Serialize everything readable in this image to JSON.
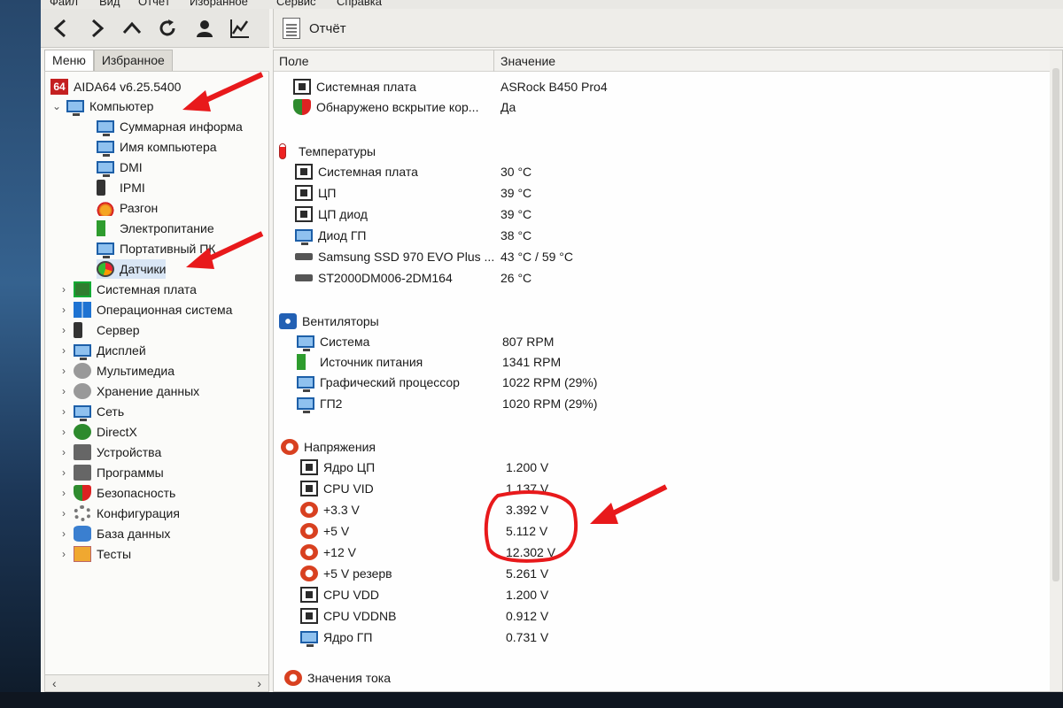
{
  "menubar": [
    "Файл",
    "Вид",
    "Отчёт",
    "Избранное",
    "Сервис",
    "Справка"
  ],
  "toolbar": {
    "buttons": [
      "back-icon",
      "forward-icon",
      "up-icon",
      "refresh-icon",
      "user-icon",
      "chart-icon"
    ],
    "report_label": "Отчёт"
  },
  "tabs": {
    "menu": "Меню",
    "favorites": "Избранное"
  },
  "tree": {
    "root": "AIDA64 v6.25.5400",
    "computer": "Компьютер",
    "computer_children": [
      "Суммарная информа",
      "Имя компьютера",
      "DMI",
      "IPMI",
      "Разгон",
      "Электропитание",
      "Портативный ПК",
      "Датчики"
    ],
    "sections": [
      "Системная плата",
      "Операционная система",
      "Сервер",
      "Дисплей",
      "Мультимедиа",
      "Хранение данных",
      "Сеть",
      "DirectX",
      "Устройства",
      "Программы",
      "Безопасность",
      "Конфигурация",
      "База данных",
      "Тесты"
    ]
  },
  "columns": {
    "field": "Поле",
    "value": "Значение"
  },
  "sensor": {
    "top": [
      {
        "label": "Системная плата",
        "value": "ASRock B450 Pro4"
      },
      {
        "label": "Обнаружено вскрытие кор...",
        "value": "Да"
      }
    ],
    "temps_title": "Температуры",
    "temps": [
      {
        "label": "Системная плата",
        "value": "30 °C"
      },
      {
        "label": "ЦП",
        "value": "39 °C"
      },
      {
        "label": "ЦП диод",
        "value": "39 °C"
      },
      {
        "label": "Диод ГП",
        "value": "38 °C"
      },
      {
        "label": "Samsung SSD 970 EVO Plus ...",
        "value": "43 °C / 59 °C"
      },
      {
        "label": "ST2000DM006-2DM164",
        "value": "26 °C"
      }
    ],
    "fans_title": "Вентиляторы",
    "fans": [
      {
        "label": "Система",
        "value": "807 RPM"
      },
      {
        "label": "Источник питания",
        "value": "1341 RPM"
      },
      {
        "label": "Графический процессор",
        "value": "1022 RPM  (29%)"
      },
      {
        "label": "ГП2",
        "value": "1020 RPM  (29%)"
      }
    ],
    "volts_title": "Напряжения",
    "volts": [
      {
        "label": "Ядро ЦП",
        "value": "1.200 V"
      },
      {
        "label": "CPU VID",
        "value": "1.137 V"
      },
      {
        "label": "+3.3 V",
        "value": "3.392 V"
      },
      {
        "label": "+5 V",
        "value": "5.112 V"
      },
      {
        "label": "+12 V",
        "value": "12.302 V"
      },
      {
        "label": "+5 V резерв",
        "value": "5.261 V"
      },
      {
        "label": "CPU VDD",
        "value": "1.200 V"
      },
      {
        "label": "CPU VDDNB",
        "value": "0.912 V"
      },
      {
        "label": "Ядро ГП",
        "value": "0.731 V"
      }
    ],
    "current_title": "Значения тока"
  },
  "colors": {
    "annotation": "#e8191b",
    "window_bg": "#f4f3f0"
  }
}
